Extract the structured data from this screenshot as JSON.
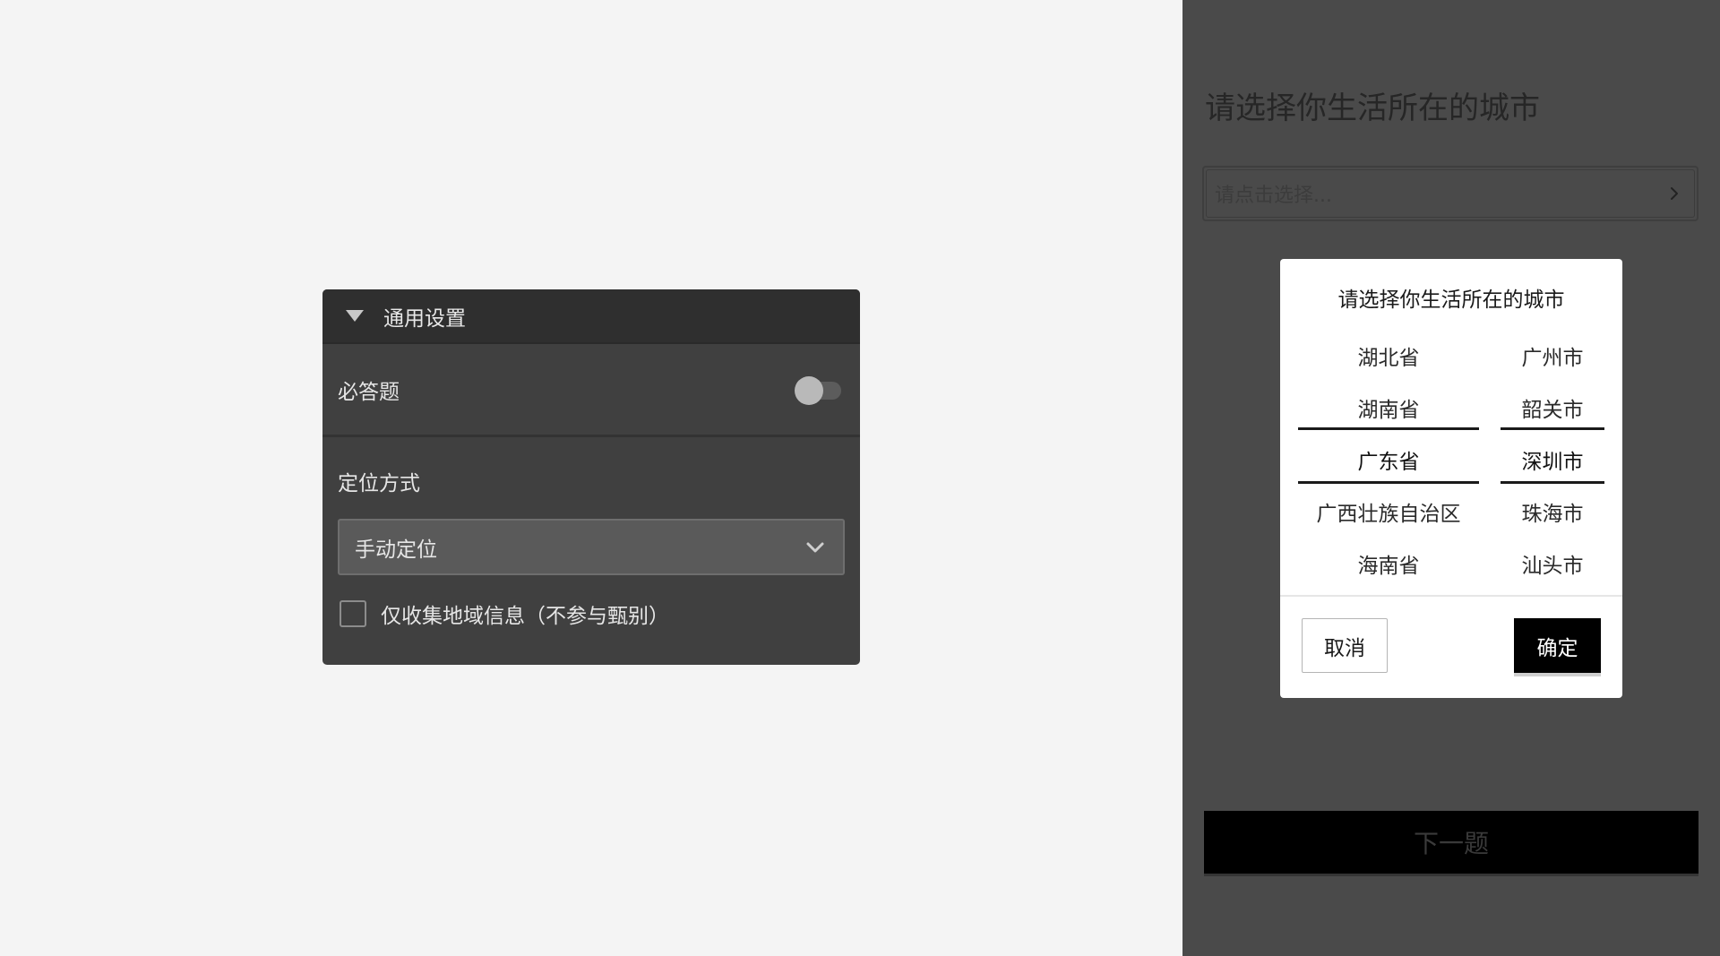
{
  "settings": {
    "header_title": "通用设置",
    "header_icon": "triangle-down-icon",
    "required_label": "必答题",
    "required_on": false,
    "location_label": "定位方式",
    "location_value": "手动定位",
    "collect_region_only_label": "仅收集地域信息（不参与甄别）",
    "collect_region_only_checked": false
  },
  "preview": {
    "question_title": "请选择你生活所在的城市",
    "input_placeholder": "请点击选择...",
    "next_button": "下一题"
  },
  "picker": {
    "title": "请选择你生活所在的城市",
    "provinces": [
      "湖北省",
      "湖南省",
      "广东省",
      "广西壮族自治区",
      "海南省"
    ],
    "cities": [
      "广州市",
      "韶关市",
      "深圳市",
      "珠海市",
      "汕头市"
    ],
    "selected_province": "广东省",
    "selected_city": "深圳市",
    "cancel": "取消",
    "confirm": "确定"
  },
  "colors": {
    "canvas": "#f4f4f4",
    "panel": "#404040",
    "panel_header": "#2f2f2f",
    "preview_bg": "#4a4a4a",
    "primary": "#000000"
  }
}
